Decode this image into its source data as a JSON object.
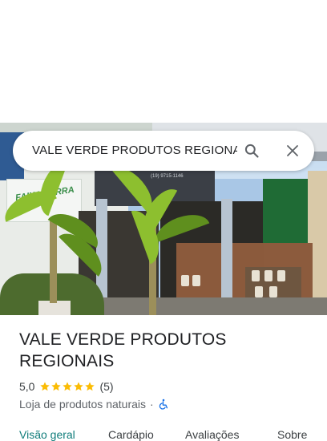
{
  "search": {
    "query": "VALE VERDE PRODUTOS REGIONAIS",
    "search_icon": "search-icon",
    "close_icon": "close-icon"
  },
  "hero": {
    "description_icon": "storefront-photo",
    "sign_text": "FAIXA-TERRA",
    "phone_text": "(19) 9715-1146"
  },
  "place": {
    "name": "VALE VERDE PRODUTOS REGIONAIS",
    "rating": "5,0",
    "stars": 5,
    "review_count": "(5)",
    "category": "Loja de produtos naturais",
    "separator": "·",
    "accessibility_icon": "wheelchair-icon"
  },
  "tabs": [
    {
      "label": "Visão geral",
      "active": true
    },
    {
      "label": "Cardápio",
      "active": false
    },
    {
      "label": "Avaliações",
      "active": false
    },
    {
      "label": "Sobre",
      "active": false
    }
  ],
  "colors": {
    "accent": "#0f7c7a",
    "star": "#fbbc04",
    "accessibility": "#1a73e8"
  }
}
